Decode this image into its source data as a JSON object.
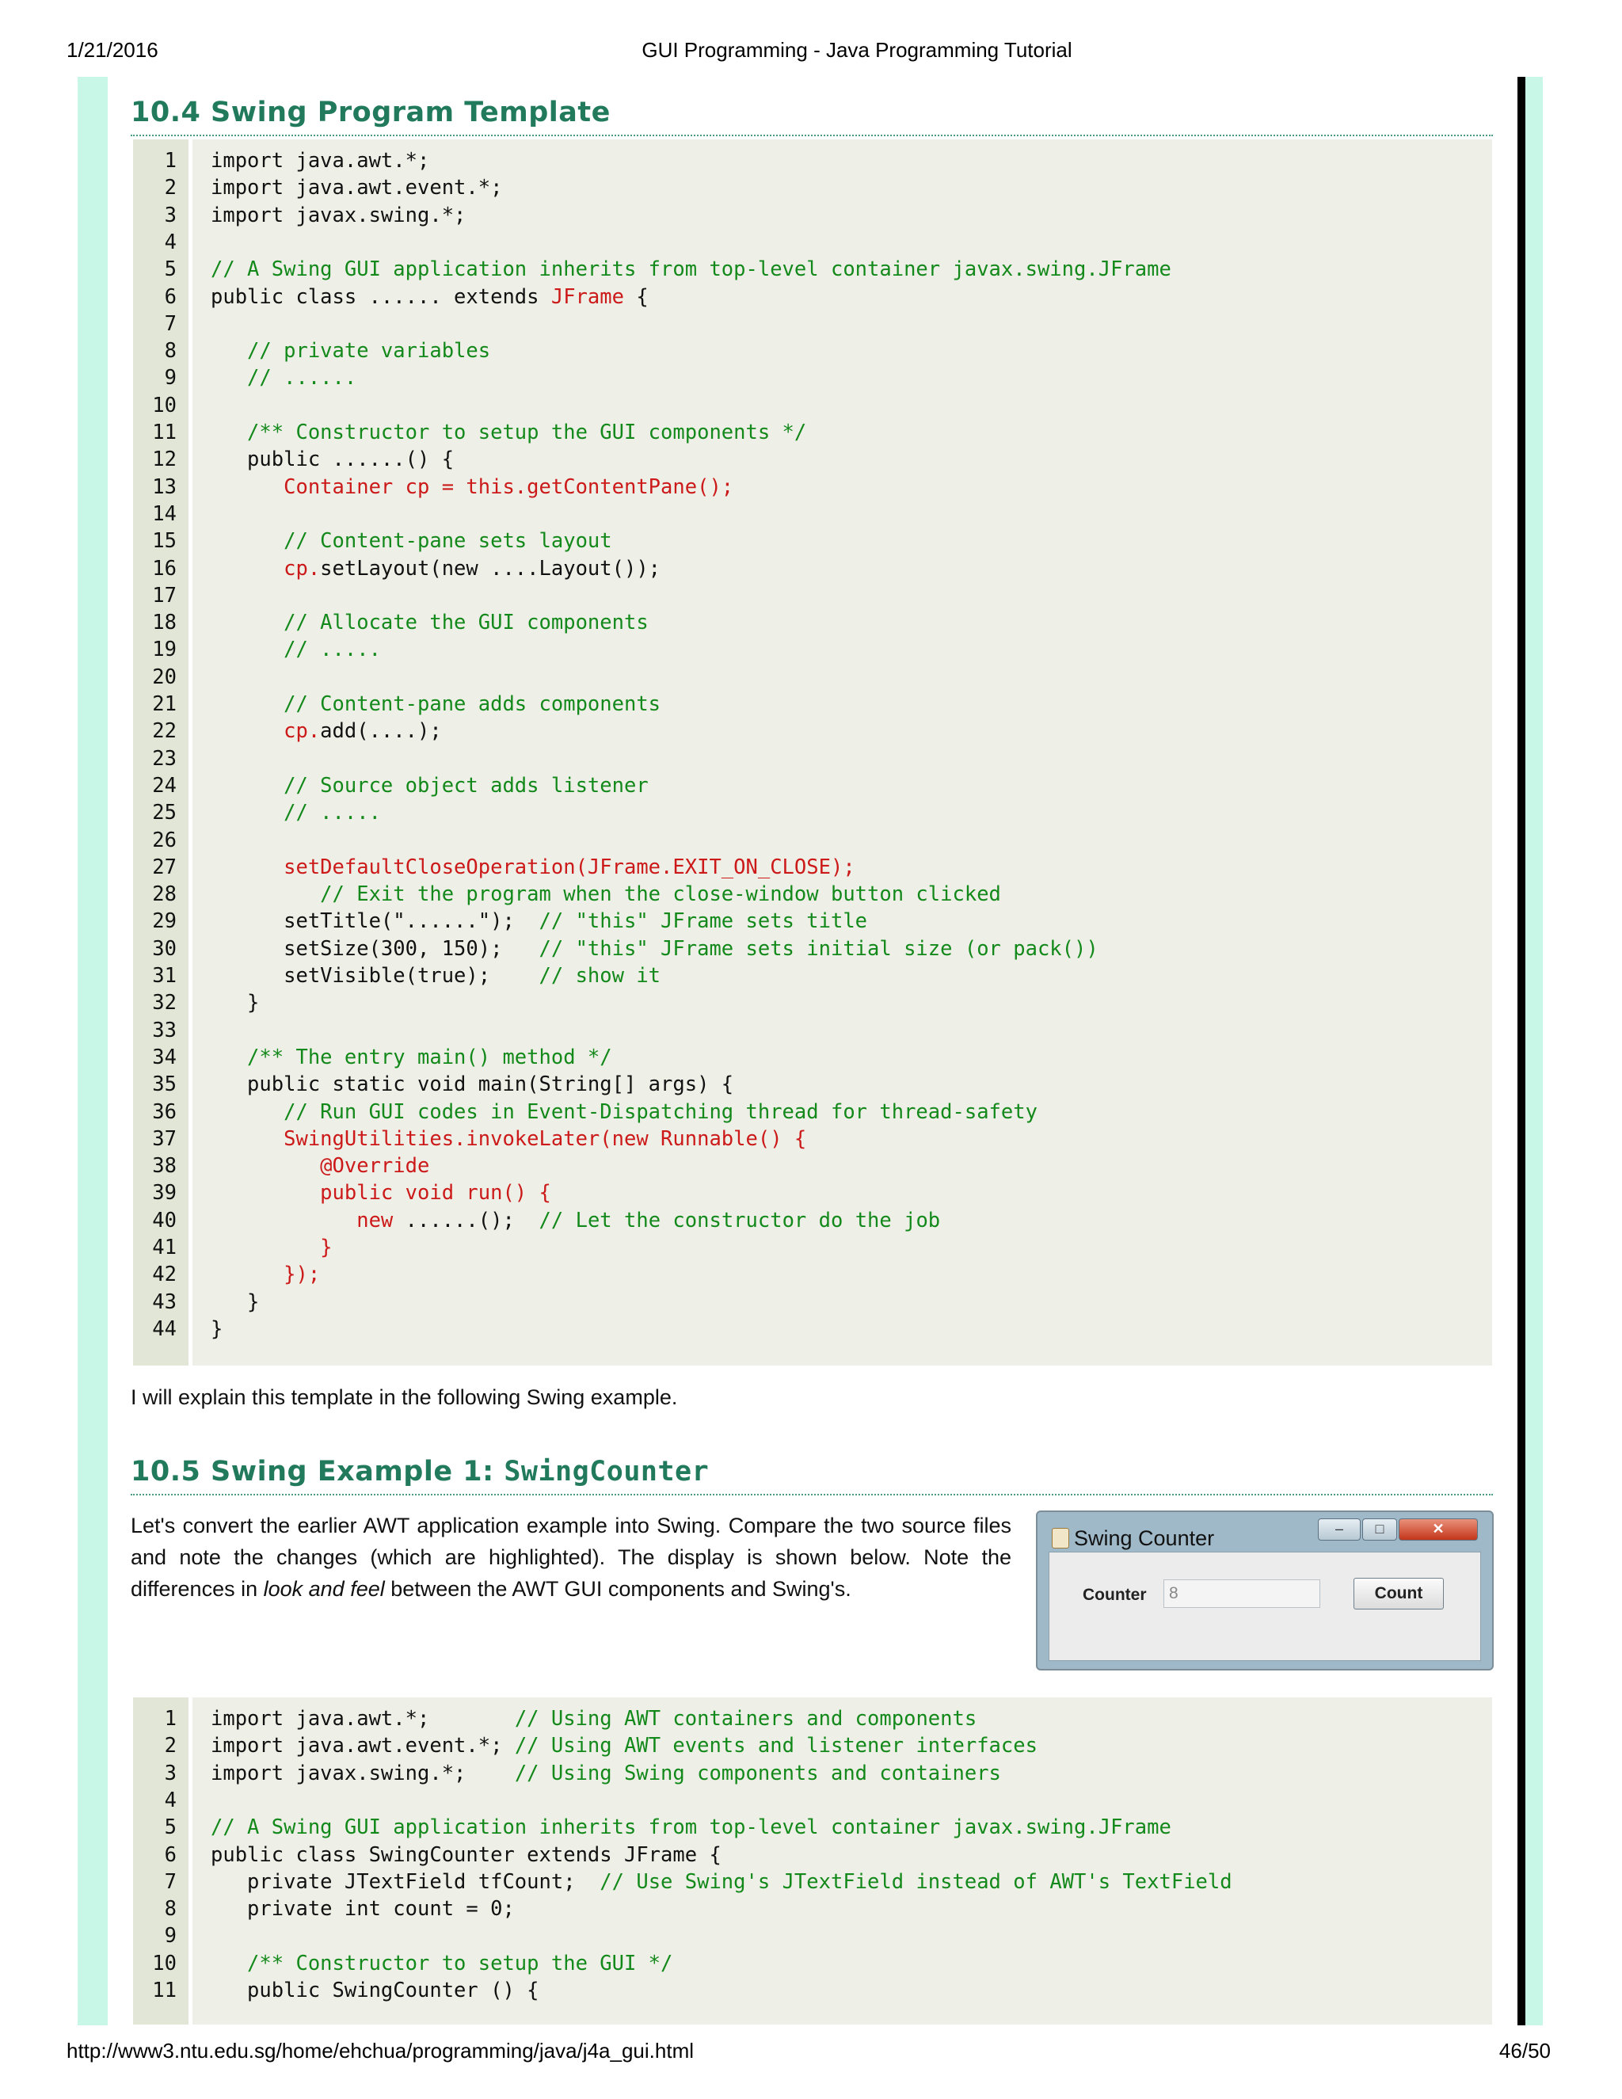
{
  "header": {
    "date": "1/21/2016",
    "title": "GUI Programming - Java Programming Tutorial"
  },
  "footer": {
    "url": "http://www3.ntu.edu.sg/home/ehchua/programming/java/j4a_gui.html",
    "page": "46/50"
  },
  "section_a": {
    "title": "10.4  Swing Program Template"
  },
  "code_a": [
    {
      "n": "1",
      "segs": [
        [
          "k",
          "import java.awt.*;"
        ]
      ]
    },
    {
      "n": "2",
      "segs": [
        [
          "k",
          "import java.awt.event.*;"
        ]
      ]
    },
    {
      "n": "3",
      "segs": [
        [
          "k",
          "import javax.swing.*;"
        ]
      ]
    },
    {
      "n": "4",
      "segs": []
    },
    {
      "n": "5",
      "segs": [
        [
          "g",
          "// A Swing GUI application inherits from top-level container javax.swing.JFrame"
        ]
      ]
    },
    {
      "n": "6",
      "segs": [
        [
          "k",
          "public class ...... extends "
        ],
        [
          "r",
          "JFrame"
        ],
        [
          "k",
          " {"
        ]
      ]
    },
    {
      "n": "7",
      "segs": []
    },
    {
      "n": "8",
      "segs": [
        [
          "g",
          "   // private variables"
        ]
      ]
    },
    {
      "n": "9",
      "segs": [
        [
          "g",
          "   // ......"
        ]
      ]
    },
    {
      "n": "10",
      "segs": []
    },
    {
      "n": "11",
      "segs": [
        [
          "g",
          "   /** Constructor to setup the GUI components */"
        ]
      ]
    },
    {
      "n": "12",
      "segs": [
        [
          "k",
          "   public ......() {"
        ]
      ]
    },
    {
      "n": "13",
      "segs": [
        [
          "r",
          "      Container cp = this.getContentPane();"
        ]
      ]
    },
    {
      "n": "14",
      "segs": []
    },
    {
      "n": "15",
      "segs": [
        [
          "g",
          "      // Content-pane sets layout"
        ]
      ]
    },
    {
      "n": "16",
      "segs": [
        [
          "r",
          "      cp."
        ],
        [
          "k",
          "setLayout(new ....Layout());"
        ]
      ]
    },
    {
      "n": "17",
      "segs": []
    },
    {
      "n": "18",
      "segs": [
        [
          "g",
          "      // Allocate the GUI components"
        ]
      ]
    },
    {
      "n": "19",
      "segs": [
        [
          "g",
          "      // ....."
        ]
      ]
    },
    {
      "n": "20",
      "segs": []
    },
    {
      "n": "21",
      "segs": [
        [
          "g",
          "      // Content-pane adds components"
        ]
      ]
    },
    {
      "n": "22",
      "segs": [
        [
          "r",
          "      cp."
        ],
        [
          "k",
          "add(....);"
        ]
      ]
    },
    {
      "n": "23",
      "segs": []
    },
    {
      "n": "24",
      "segs": [
        [
          "g",
          "      // Source object adds listener"
        ]
      ]
    },
    {
      "n": "25",
      "segs": [
        [
          "g",
          "      // ....."
        ]
      ]
    },
    {
      "n": "26",
      "segs": []
    },
    {
      "n": "27",
      "segs": [
        [
          "r",
          "      setDefaultCloseOperation(JFrame.EXIT_ON_CLOSE);"
        ]
      ]
    },
    {
      "n": "28",
      "segs": [
        [
          "g",
          "         // Exit the program when the close-window button clicked"
        ]
      ]
    },
    {
      "n": "29",
      "segs": [
        [
          "k",
          "      setTitle(\"......\");  "
        ],
        [
          "g",
          "// \"this\" JFrame sets title"
        ]
      ]
    },
    {
      "n": "30",
      "segs": [
        [
          "k",
          "      setSize(300, 150);   "
        ],
        [
          "g",
          "// \"this\" JFrame sets initial size (or pack())"
        ]
      ]
    },
    {
      "n": "31",
      "segs": [
        [
          "k",
          "      setVisible(true);    "
        ],
        [
          "g",
          "// show it"
        ]
      ]
    },
    {
      "n": "32",
      "segs": [
        [
          "k",
          "   }"
        ]
      ]
    },
    {
      "n": "33",
      "segs": []
    },
    {
      "n": "34",
      "segs": [
        [
          "g",
          "   /** The entry main() method */"
        ]
      ]
    },
    {
      "n": "35",
      "segs": [
        [
          "k",
          "   public static void main(String[] args) {"
        ]
      ]
    },
    {
      "n": "36",
      "segs": [
        [
          "g",
          "      // Run GUI codes in Event-Dispatching thread for thread-safety"
        ]
      ]
    },
    {
      "n": "37",
      "segs": [
        [
          "r",
          "      SwingUtilities.invokeLater(new Runnable() {"
        ]
      ]
    },
    {
      "n": "38",
      "segs": [
        [
          "r",
          "         @Override"
        ]
      ]
    },
    {
      "n": "39",
      "segs": [
        [
          "r",
          "         public void run() {"
        ]
      ]
    },
    {
      "n": "40",
      "segs": [
        [
          "r",
          "            new "
        ],
        [
          "k",
          "......();  "
        ],
        [
          "g",
          "// Let the constructor do the job"
        ]
      ]
    },
    {
      "n": "41",
      "segs": [
        [
          "r",
          "         }"
        ]
      ]
    },
    {
      "n": "42",
      "segs": [
        [
          "r",
          "      });"
        ]
      ]
    },
    {
      "n": "43",
      "segs": [
        [
          "k",
          "   }"
        ]
      ]
    },
    {
      "n": "44",
      "segs": [
        [
          "k",
          "}"
        ]
      ]
    }
  ],
  "para_a": "I will explain this template in the following Swing example.",
  "section_b": {
    "title_prefix": "10.5  Swing Example 1: ",
    "title_code": "SwingCounter"
  },
  "para_b": {
    "before": "Let's convert the earlier AWT application example into Swing. Compare the two source files and note the changes (which are highlighted). The display is shown below. Note the differences in ",
    "em": "look and feel",
    "after": " between the AWT GUI components and Swing's."
  },
  "window": {
    "title": "Swing Counter",
    "label": "Counter",
    "field_value": "8",
    "button": "Count",
    "min_glyph": "–",
    "max_glyph": "□",
    "close_glyph": "✕"
  },
  "code_b": [
    {
      "n": "1",
      "segs": [
        [
          "k",
          "import java.awt.*;       "
        ],
        [
          "g",
          "// Using AWT containers and components"
        ]
      ]
    },
    {
      "n": "2",
      "segs": [
        [
          "k",
          "import java.awt.event.*; "
        ],
        [
          "g",
          "// Using AWT events and listener interfaces"
        ]
      ]
    },
    {
      "n": "3",
      "segs": [
        [
          "k",
          "import javax.swing.*;    "
        ],
        [
          "g",
          "// Using Swing components and containers"
        ]
      ]
    },
    {
      "n": "4",
      "segs": []
    },
    {
      "n": "5",
      "segs": [
        [
          "g",
          "// A Swing GUI application inherits from top-level container javax.swing.JFrame"
        ]
      ]
    },
    {
      "n": "6",
      "segs": [
        [
          "k",
          "public class SwingCounter extends JFrame {"
        ]
      ]
    },
    {
      "n": "7",
      "segs": [
        [
          "k",
          "   private JTextField tfCount;  "
        ],
        [
          "g",
          "// Use Swing's JTextField instead of AWT's TextField"
        ]
      ]
    },
    {
      "n": "8",
      "segs": [
        [
          "k",
          "   private int count = 0;"
        ]
      ]
    },
    {
      "n": "9",
      "segs": []
    },
    {
      "n": "10",
      "segs": [
        [
          "g",
          "   /** Constructor to setup the GUI */"
        ]
      ]
    },
    {
      "n": "11",
      "segs": [
        [
          "k",
          "   public SwingCounter () {"
        ]
      ]
    }
  ]
}
